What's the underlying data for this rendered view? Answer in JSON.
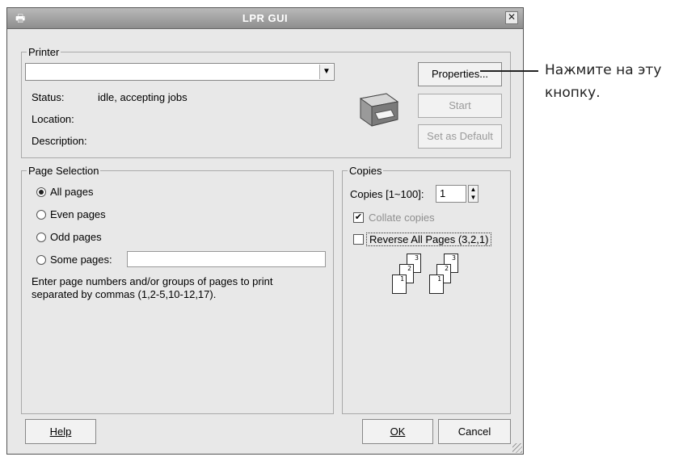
{
  "window": {
    "title": "LPR GUI",
    "close_glyph": "✕",
    "app_icon": "printer-app-icon"
  },
  "printer": {
    "group_label": "Printer",
    "selected_printer": "",
    "status_label": "Status:",
    "status_value": "idle, accepting jobs",
    "location_label": "Location:",
    "description_label": "Description:",
    "properties_button": "Properties...",
    "start_button": "Start",
    "default_button": "Set as Default"
  },
  "page_selection": {
    "group_label": "Page Selection",
    "options": [
      "All pages",
      "Even pages",
      "Odd pages",
      "Some pages:"
    ],
    "selected_index": 0,
    "hint_line1": "Enter page numbers and/or groups of pages to print",
    "hint_line2": "separated by commas (1,2-5,10-12,17)."
  },
  "copies": {
    "group_label": "Copies",
    "copies_label": "Copies [1~100]:",
    "copies_value": "1",
    "collate_label": "Collate copies",
    "collate_checked": true,
    "reverse_label": "Reverse All Pages (3,2,1)",
    "reverse_checked": false,
    "page_numbers": [
      "1",
      "2",
      "3"
    ]
  },
  "footer": {
    "help_button": "Help",
    "ok_button": "OK",
    "cancel_button": "Cancel"
  },
  "annotation": {
    "line1": "Нажмите на эту",
    "line2": "кнопку."
  }
}
